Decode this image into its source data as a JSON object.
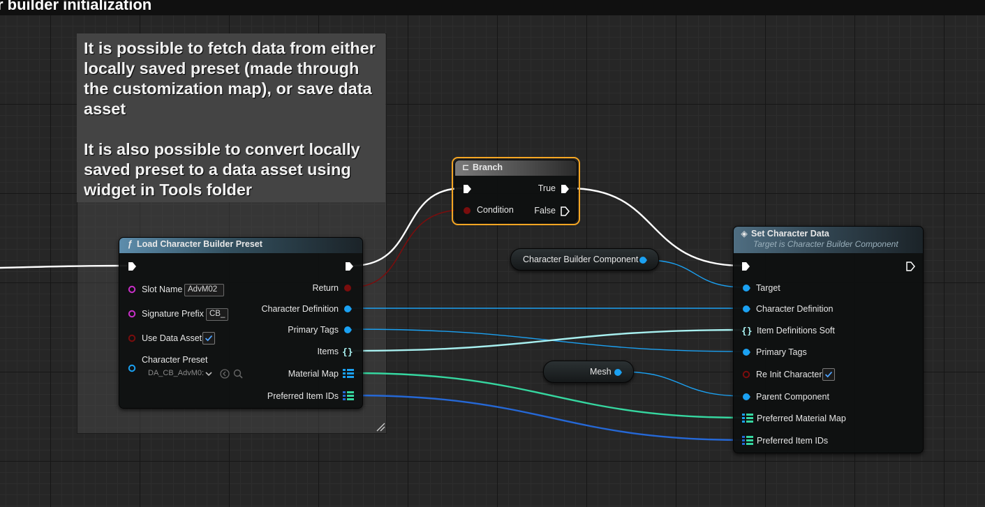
{
  "graph": {
    "title": "r builder initialization"
  },
  "comment": {
    "text": "It is possible to fetch data from either\nlocally saved preset (made through\nthe customization map), or save data\nasset\n\nIt is also possible to convert locally\nsaved preset to a data asset using\nwidget in Tools folder"
  },
  "load_node": {
    "title": "Load Character Builder Preset",
    "inputs": {
      "slot_name": "Slot Name",
      "slot_name_value": "AdvM02",
      "signature_prefix": "Signature Prefix",
      "signature_prefix_value": "CB_",
      "use_data_asset": "Use Data Asset",
      "use_data_asset_checked": true,
      "character_preset": "Character Preset",
      "character_preset_value": "DA_CB_AdvM0:"
    },
    "outputs": {
      "return": "Return",
      "character_definition": "Character Definition",
      "primary_tags": "Primary Tags",
      "items": "Items",
      "material_map": "Material Map",
      "preferred_item_ids": "Preferred Item IDs"
    }
  },
  "branch_node": {
    "title": "Branch",
    "condition": "Condition",
    "true_label": "True",
    "false_label": "False"
  },
  "vars": {
    "component": "Character Builder Component",
    "mesh": "Mesh"
  },
  "set_node": {
    "title": "Set Character Data",
    "subtitle": "Target is Character Builder Component",
    "inputs": {
      "target": "Target",
      "character_definition": "Character Definition",
      "item_definitions_soft": "Item Definitions Soft",
      "primary_tags": "Primary Tags",
      "re_init_character": "Re Init Character",
      "re_init_checked": true,
      "parent_component": "Parent Component",
      "preferred_material_map": "Preferred Material Map",
      "preferred_item_ids": "Preferred Item IDs"
    }
  },
  "colors": {
    "exec": "#ffffff",
    "bool": "#7a0d0d",
    "name": "#c92fc9",
    "object": "#1ba1f2",
    "struct": "#a8f0f0",
    "map": "#36d7a0",
    "array_blue": "#2568d6",
    "selection": "#f5a623"
  }
}
